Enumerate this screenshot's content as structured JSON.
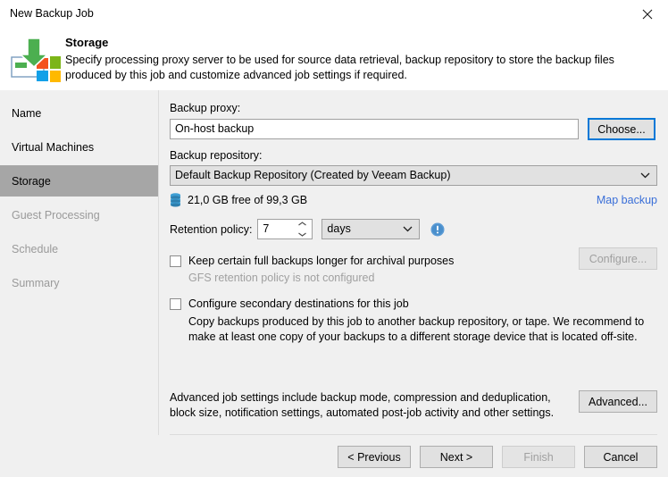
{
  "window": {
    "title": "New Backup Job",
    "close_icon": "close-icon"
  },
  "header": {
    "icon": "storage-backup-windows-icon",
    "title": "Storage",
    "description": "Specify processing proxy server to be used for source data retrieval, backup repository to store the backup files produced by this job and customize advanced job settings if required."
  },
  "sidebar": {
    "items": [
      {
        "label": "Name",
        "state": "done"
      },
      {
        "label": "Virtual Machines",
        "state": "done"
      },
      {
        "label": "Storage",
        "state": "active"
      },
      {
        "label": "Guest Processing",
        "state": "pending"
      },
      {
        "label": "Schedule",
        "state": "pending"
      },
      {
        "label": "Summary",
        "state": "pending"
      }
    ]
  },
  "main": {
    "backup_proxy": {
      "label": "Backup proxy:",
      "value": "On-host backup",
      "choose_button": "Choose..."
    },
    "backup_repository": {
      "label": "Backup repository:",
      "value": "Default Backup Repository (Created by Veeam Backup)",
      "dropdown_icon": "chevron-down-icon"
    },
    "free_space": {
      "icon": "disk-stack-icon",
      "text": "21,0 GB free of 99,3 GB",
      "map_backup_link": "Map backup"
    },
    "retention": {
      "label": "Retention policy:",
      "value": "7",
      "unit": "days",
      "unit_dropdown_icon": "chevron-down-icon",
      "spinner_icon": "spinner-arrows-icon",
      "info_icon": "info-exclamation-icon"
    },
    "gfs": {
      "checkbox_label": "Keep certain full backups longer for archival purposes",
      "note": "GFS retention policy is not configured",
      "configure_button": "Configure...",
      "configure_disabled": true,
      "checked": false
    },
    "secondary": {
      "checkbox_label": "Configure secondary destinations for this job",
      "description": "Copy backups produced by this job to another backup repository, or tape. We recommend to make at least one copy of your backups to a different storage device that is located off-site.",
      "checked": false
    },
    "advanced": {
      "description": "Advanced job settings include backup mode, compression and deduplication, block size, notification settings, automated post-job activity and other settings.",
      "button": "Advanced..."
    }
  },
  "footer": {
    "previous": "< Previous",
    "next": "Next >",
    "finish": "Finish",
    "cancel": "Cancel",
    "finish_disabled": true
  },
  "colors": {
    "accent": "#0078d7",
    "link": "#3a6fd8",
    "selected_nav": "#a6a6a6",
    "panel": "#f0f0f0",
    "disabled_text": "#a0a0a0"
  }
}
